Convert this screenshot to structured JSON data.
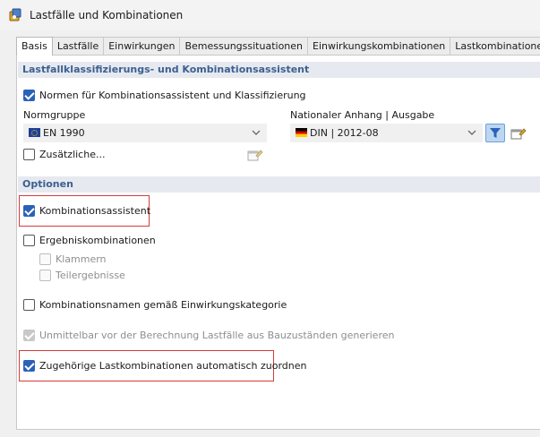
{
  "window": {
    "title": "Lastfälle und Kombinationen"
  },
  "tabs": [
    {
      "label": "Basis",
      "active": true
    },
    {
      "label": "Lastfälle",
      "active": false
    },
    {
      "label": "Einwirkungen",
      "active": false
    },
    {
      "label": "Bemessungssituationen",
      "active": false
    },
    {
      "label": "Einwirkungskombinationen",
      "active": false
    },
    {
      "label": "Lastkombinationen",
      "active": false
    }
  ],
  "assistant": {
    "header": "Lastfallklassifizierungs- und Kombinationsassistent",
    "norms_checkbox": {
      "label": "Normen für Kombinationsassistent und Klassifizierung",
      "checked": true
    },
    "norm_group": {
      "label": "Normgruppe",
      "value": "EN 1990",
      "flag": "eu-flag"
    },
    "national_annex": {
      "label": "Nationaler Anhang | Ausgabe",
      "value": "DIN | 2012-08",
      "flag": "de-flag"
    },
    "additional_checkbox": {
      "label": "Zusätzliche...",
      "checked": false
    }
  },
  "options": {
    "header": "Optionen",
    "combination_assistant": {
      "label": "Kombinationsassistent",
      "checked": true
    },
    "result_combinations": {
      "label": "Ergebniskombinationen",
      "checked": false
    },
    "brackets": {
      "label": "Klammern",
      "checked": false,
      "enabled": false
    },
    "partial_results": {
      "label": "Teilergebnisse",
      "checked": false,
      "enabled": false
    },
    "naming_by_category": {
      "label": "Kombinationsnamen gemäß Einwirkungskategorie",
      "checked": false
    },
    "generate_from_construction_stages": {
      "label": "Unmittelbar vor der Berechnung Lastfälle aus Bauzuständen generieren",
      "checked": true,
      "enabled": false
    },
    "auto_assign_load_combinations": {
      "label": "Zugehörige Lastkombinationen automatisch zuordnen",
      "checked": true
    }
  },
  "colors": {
    "accent": "#2b62b8",
    "header_text": "#3d5f8f",
    "highlight_box": "#d63b3b"
  }
}
